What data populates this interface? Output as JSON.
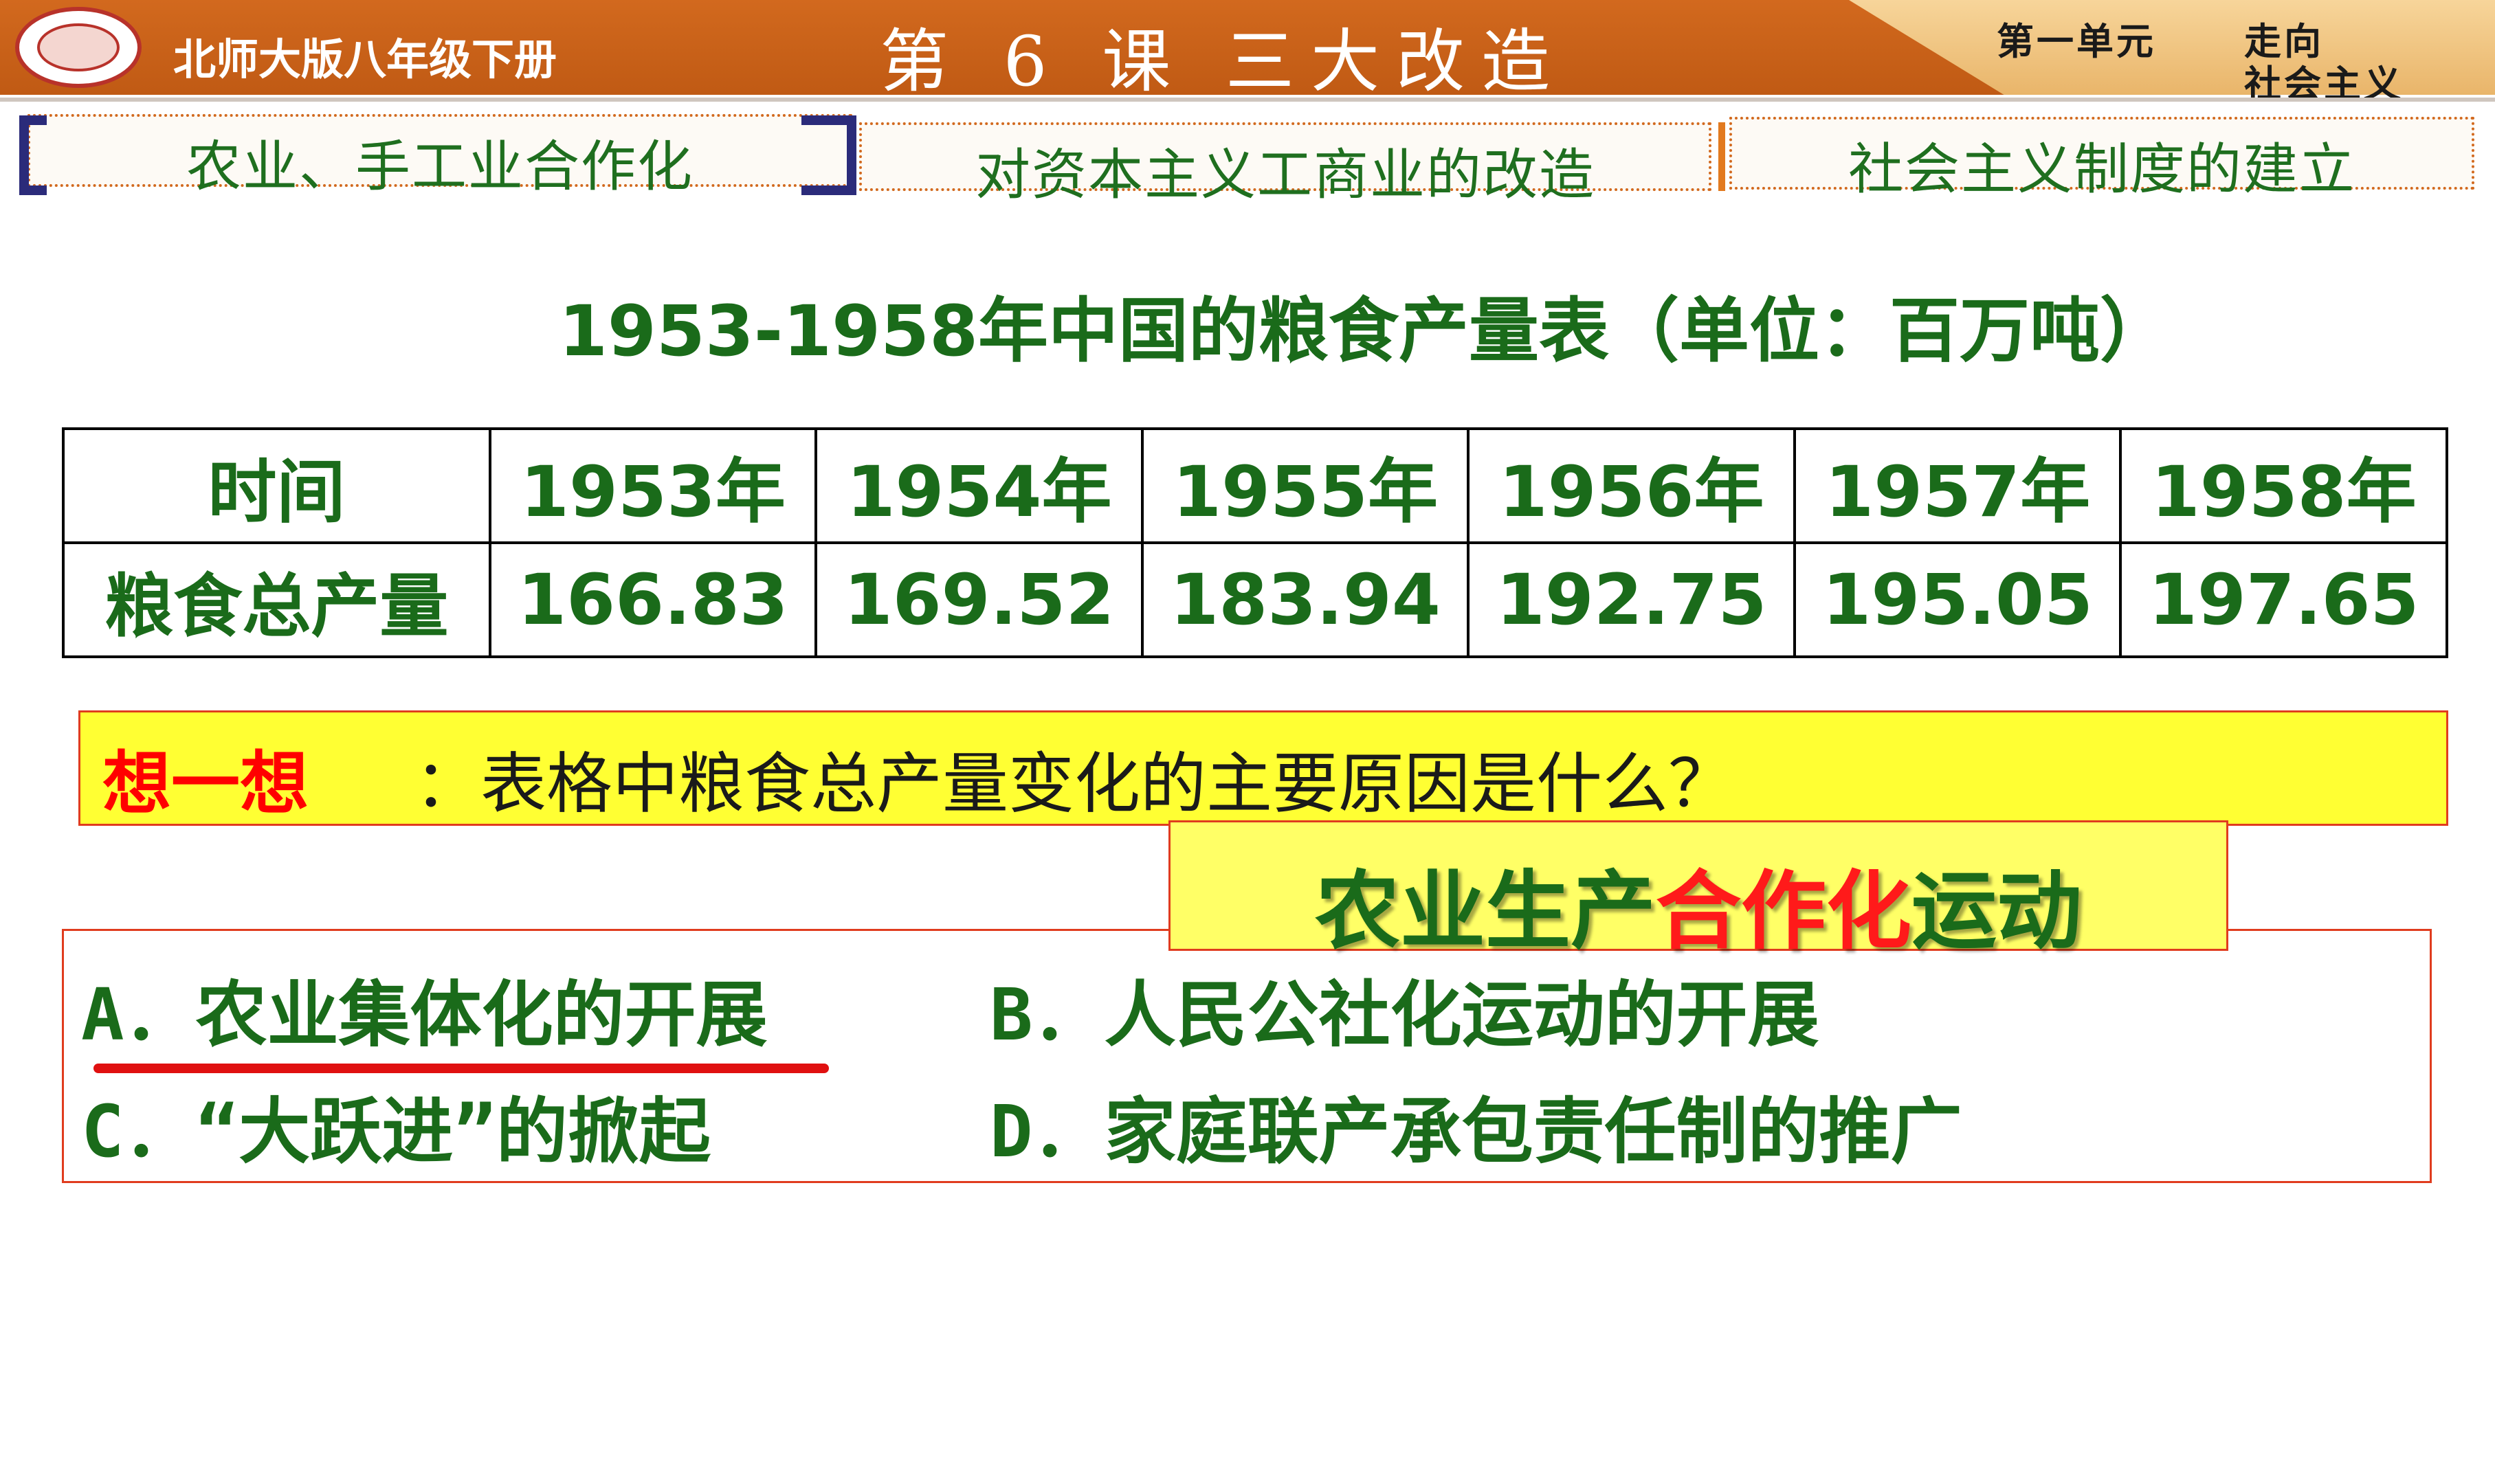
{
  "header": {
    "textbook": "北师大版八年级下册",
    "lesson_title": "第 6 课  三大改造",
    "unit_label": "第一单元",
    "unit_title_line1": "走向",
    "unit_title_line2": "社会主义"
  },
  "tabs": [
    {
      "label": "农业、手工业合作化"
    },
    {
      "label": "对资本主义工商业的改造"
    },
    {
      "label": "社会主义制度的建立"
    }
  ],
  "table_title": "1953-1958年中国的粮食产量表（单位：百万吨）",
  "table": {
    "row_headers": [
      "时间",
      "粮食总产量"
    ],
    "years": [
      "1953年",
      "1954年",
      "1955年",
      "1956年",
      "1957年",
      "1958年"
    ],
    "values": [
      "166.83",
      "169.52",
      "183.94",
      "192.75",
      "195.05",
      "197.65"
    ]
  },
  "question": {
    "prefix": "想一想",
    "text": "：表格中粮食总产量变化的主要原因是什么？"
  },
  "answer_popup": {
    "part1": "农业生产",
    "part2": "合作化",
    "part3": "运动"
  },
  "options": {
    "a": "A．农业集体化的开展",
    "b": "B．人民公社化运动的开展",
    "c": "C．“大跃进”的掀起",
    "d": "D．家庭联产承包责任制的推广"
  },
  "colors": {
    "header_bg": "#c9621a",
    "text_green": "#1a6b1a",
    "highlight_yellow": "#ffff33",
    "accent_red": "#ff0000"
  }
}
